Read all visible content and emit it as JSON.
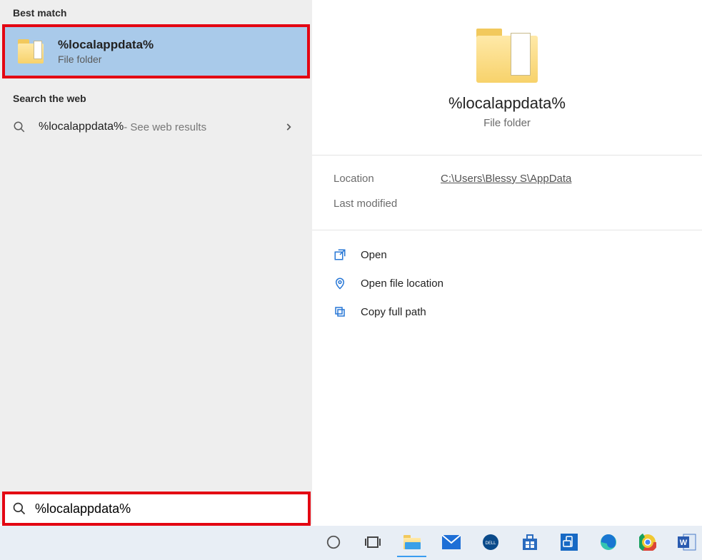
{
  "left": {
    "best_match_header": "Best match",
    "best_match": {
      "title": "%localappdata%",
      "subtitle": "File folder"
    },
    "web_header": "Search the web",
    "web_item": {
      "title": "%localappdata%",
      "suffix": " - See web results"
    }
  },
  "preview": {
    "title": "%localappdata%",
    "subtitle": "File folder",
    "location_label": "Location",
    "location_value": "C:\\Users\\Blessy S\\AppData",
    "last_modified_label": "Last modified"
  },
  "actions": {
    "open": "Open",
    "open_file_location": "Open file location",
    "copy_full_path": "Copy full path"
  },
  "search": {
    "value": "%localappdata%"
  },
  "taskbar": {
    "items": [
      "cortana",
      "task-view",
      "file-explorer",
      "mail",
      "dell",
      "store",
      "your-phone",
      "edge",
      "chrome",
      "word"
    ]
  }
}
